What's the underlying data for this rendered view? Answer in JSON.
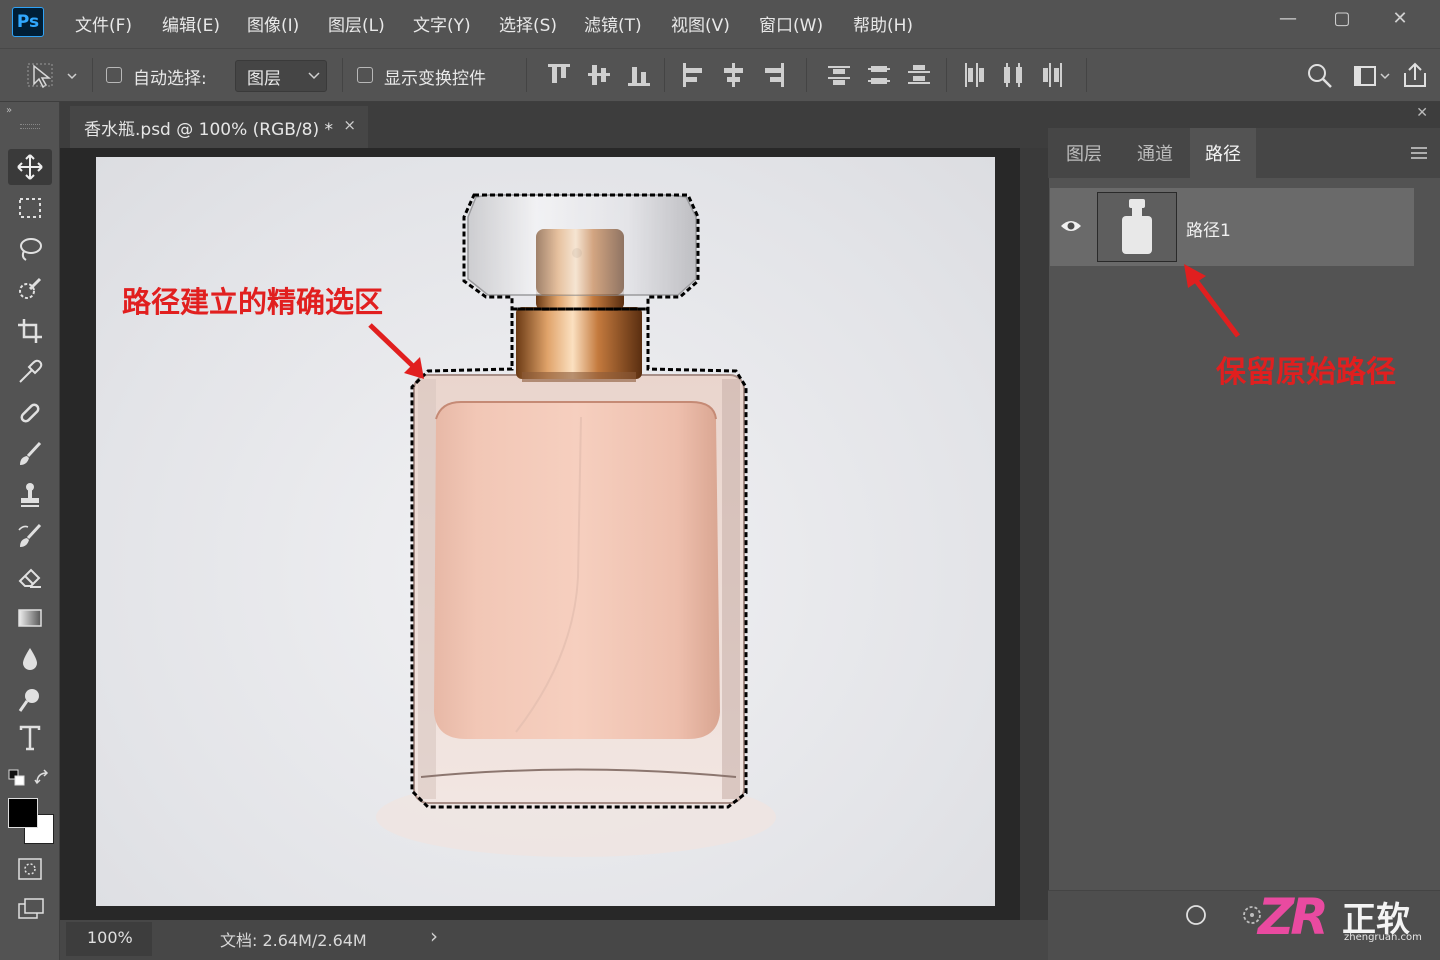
{
  "app": {
    "logo": "Ps",
    "menu": [
      "文件(F)",
      "编辑(E)",
      "图像(I)",
      "图层(L)",
      "文字(Y)",
      "选择(S)",
      "滤镜(T)",
      "视图(V)",
      "窗口(W)",
      "帮助(H)"
    ],
    "window_controls": {
      "minimize": "—",
      "restore": "▢",
      "close": "✕"
    }
  },
  "options_bar": {
    "auto_select_label": "自动选择:",
    "auto_select_checked": false,
    "target_select_value": "图层",
    "show_transform_label": "显示变换控件",
    "show_transform_checked": false
  },
  "document": {
    "tab_title": "香水瓶.psd @ 100% (RGB/8) *",
    "tab_close": "×",
    "zoom": "100%",
    "doc_info": "文档: 2.64M/2.64M",
    "status_arrow": "›"
  },
  "panel": {
    "tabs": [
      "图层",
      "通道",
      "路径"
    ],
    "active_tab": "路径",
    "paths": [
      {
        "name": "路径1",
        "visible": true
      }
    ]
  },
  "annotations": {
    "left_note": "路径建立的精确选区",
    "right_note": "保留原始路径",
    "color": "#e11f1f"
  },
  "watermark": {
    "brand": "ZR",
    "name": "正软",
    "site": "zhengruan.com"
  },
  "icons": {
    "tools": [
      "move-icon",
      "marquee-icon",
      "lasso-icon",
      "quick-select-icon",
      "crop-icon",
      "eyedropper-icon",
      "healing-brush-icon",
      "brush-icon",
      "clone-stamp-icon",
      "history-brush-icon",
      "eraser-icon",
      "gradient-icon",
      "blur-icon",
      "dodge-icon",
      "type-icon"
    ]
  }
}
